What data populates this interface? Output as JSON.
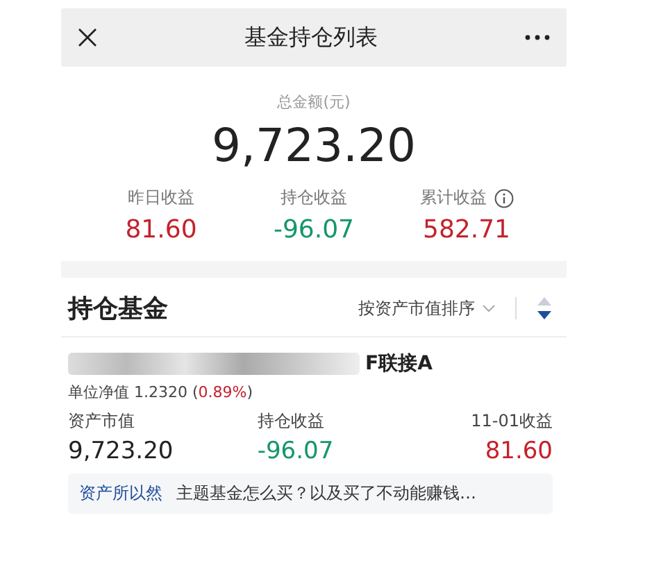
{
  "title_bar": {
    "title": "基金持仓列表"
  },
  "summary": {
    "label": "总金额(元)",
    "amount": "9,723.20",
    "stats": [
      {
        "label": "昨日收益",
        "value": "81.60",
        "color": "#c4222b",
        "info": false
      },
      {
        "label": "持仓收益",
        "value": "-96.07",
        "color": "#15966c",
        "info": false
      },
      {
        "label": "累计收益",
        "value": "582.71",
        "color": "#c4222b",
        "info": true
      }
    ]
  },
  "holdings": {
    "heading": "持仓基金",
    "sort_label": "按资产市值排序",
    "funds": [
      {
        "name_visible": "F联接A",
        "nav_prefix": "单位净值 1.2320 (",
        "nav_change": "0.89%",
        "nav_suffix": ")",
        "columns": [
          {
            "label": "资产市值",
            "value": "9,723.20",
            "color": "#222222"
          },
          {
            "label": "持仓收益",
            "value": "-96.07",
            "color": "#15966c"
          },
          {
            "label": "11-01收益",
            "value": "81.60",
            "color": "#c4222b"
          }
        ]
      }
    ]
  },
  "banner": {
    "tag": "资产所以然",
    "text": "主题基金怎么买？以及买了不动能赚钱…"
  }
}
